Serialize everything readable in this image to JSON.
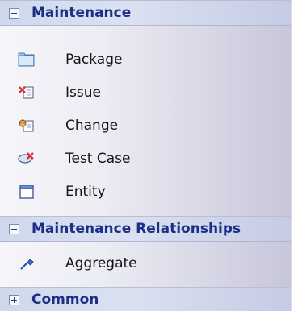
{
  "sections": [
    {
      "title": "Maintenance",
      "state": "expanded",
      "items": [
        {
          "label": "Package",
          "icon": "package-icon"
        },
        {
          "label": "Issue",
          "icon": "issue-icon"
        },
        {
          "label": "Change",
          "icon": "change-icon"
        },
        {
          "label": "Test Case",
          "icon": "test-case-icon"
        },
        {
          "label": "Entity",
          "icon": "entity-icon"
        }
      ]
    },
    {
      "title": "Maintenance Relationships",
      "state": "expanded",
      "items": [
        {
          "label": "Aggregate",
          "icon": "aggregate-icon"
        }
      ]
    },
    {
      "title": "Common",
      "state": "collapsed",
      "items": []
    }
  ],
  "colors": {
    "header_text": "#1b2f86",
    "item_text": "#151515",
    "accent_blue": "#3d66d1",
    "accent_red": "#d62b2b"
  }
}
